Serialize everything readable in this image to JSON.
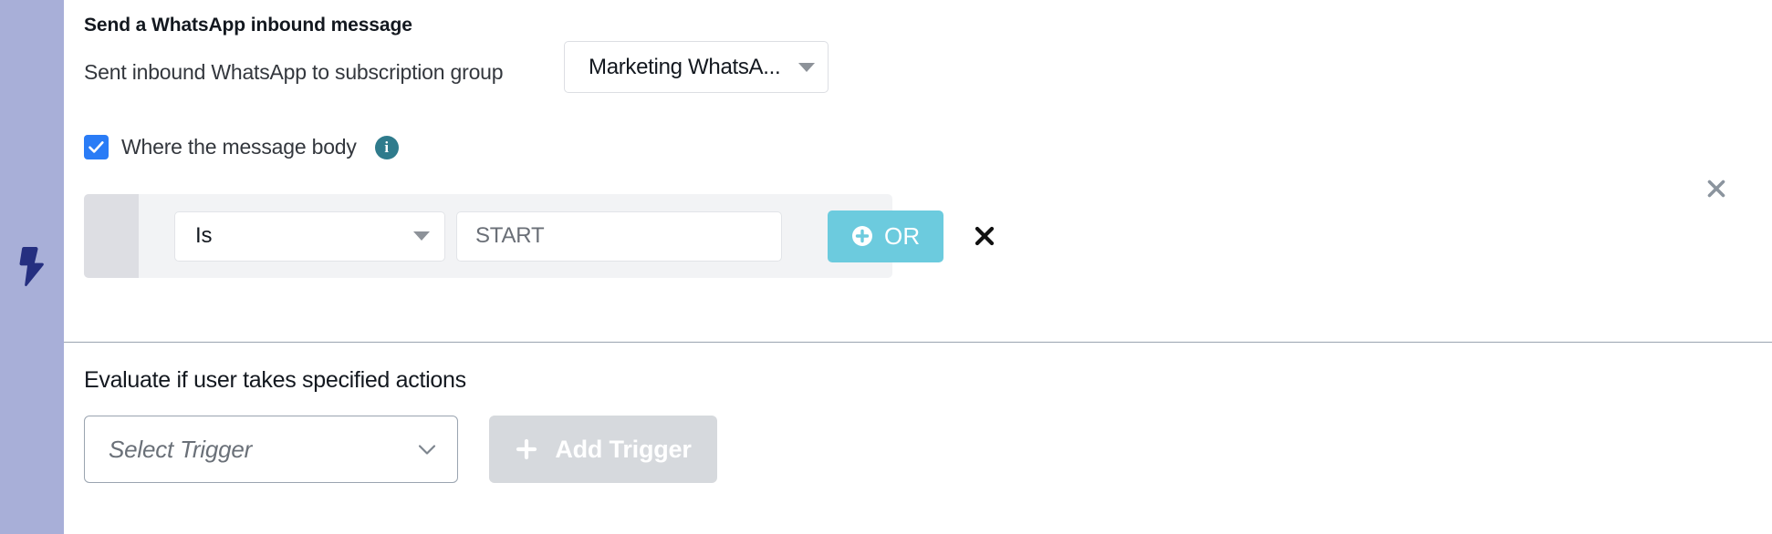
{
  "rail": {
    "icon": "lightning-bolt-icon",
    "background_color": "#a8afd8",
    "icon_color": "#252f80"
  },
  "trigger_block": {
    "title": "Send a WhatsApp inbound message",
    "subscription_row": {
      "label": "Sent inbound WhatsApp to subscription group",
      "select": {
        "value": "Marketing WhatsA...",
        "icon": "caret-down-icon"
      }
    },
    "message_body_filter": {
      "checked": true,
      "label": "Where the message body",
      "info_icon": "info-icon",
      "accent_color": "#2a7cf6"
    },
    "condition_row": {
      "operator": {
        "value": "Is",
        "icon": "caret-down-icon"
      },
      "value_input": {
        "value": "",
        "placeholder": "START"
      },
      "or_button": {
        "label": "OR",
        "icon": "plus-circle-icon",
        "color": "#6ccbde"
      },
      "delete_icon": "close-icon"
    },
    "close_icon": "close-icon"
  },
  "actions_block": {
    "label": "Evaluate if user takes specified actions",
    "trigger_select": {
      "placeholder": "Select Trigger",
      "icon": "chevron-down-icon"
    },
    "add_trigger_button": {
      "label": "Add Trigger",
      "icon": "plus-icon",
      "disabled": true,
      "color": "#d6d9dd"
    }
  }
}
